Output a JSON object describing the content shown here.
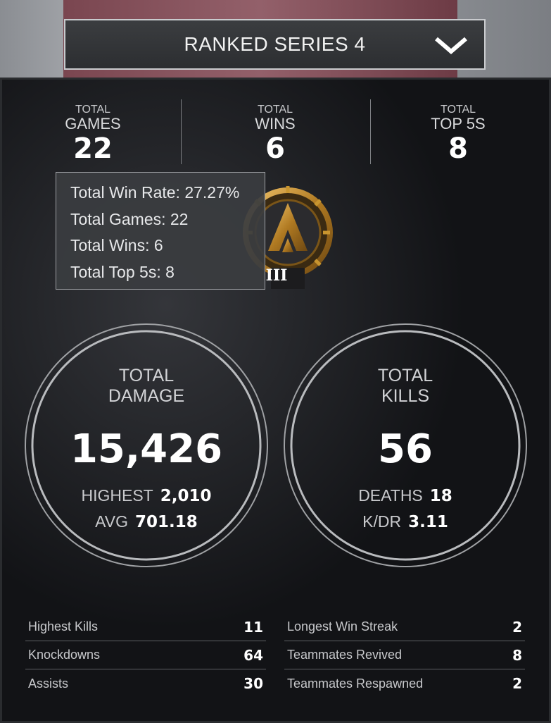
{
  "header": {
    "season_label": "RANKED SERIES 4"
  },
  "top_stats": [
    {
      "small": "TOTAL",
      "big": "GAMES",
      "value": "22"
    },
    {
      "small": "TOTAL",
      "big": "WINS",
      "value": "6"
    },
    {
      "small": "TOTAL",
      "big": "TOP 5S",
      "value": "8"
    }
  ],
  "badge": {
    "tier": "III"
  },
  "tooltip": {
    "lines": [
      "Total Win Rate: 27.27%",
      "Total Games: 22",
      "Total Wins: 6",
      "Total Top 5s: 8"
    ]
  },
  "damage": {
    "label_1": "TOTAL",
    "label_2": "DAMAGE",
    "value": "15,426",
    "row1_key": "HIGHEST",
    "row1_val": "2,010",
    "row2_key": "AVG",
    "row2_val": "701.18"
  },
  "kills": {
    "label_1": "TOTAL",
    "label_2": "KILLS",
    "value": "56",
    "row1_key": "DEATHS",
    "row1_val": "18",
    "row2_key": "K/DR",
    "row2_val": "3.11"
  },
  "table_left": [
    {
      "label": "Highest Kills",
      "value": "11"
    },
    {
      "label": "Knockdowns",
      "value": "64"
    },
    {
      "label": "Assists",
      "value": "30"
    }
  ],
  "table_right": [
    {
      "label": "Longest Win Streak",
      "value": "2"
    },
    {
      "label": "Teammates Revived",
      "value": "8"
    },
    {
      "label": "Teammates Respawned",
      "value": "2"
    }
  ],
  "colors": {
    "badge_gold": "#c8952f",
    "panel_bg": "#121316"
  }
}
